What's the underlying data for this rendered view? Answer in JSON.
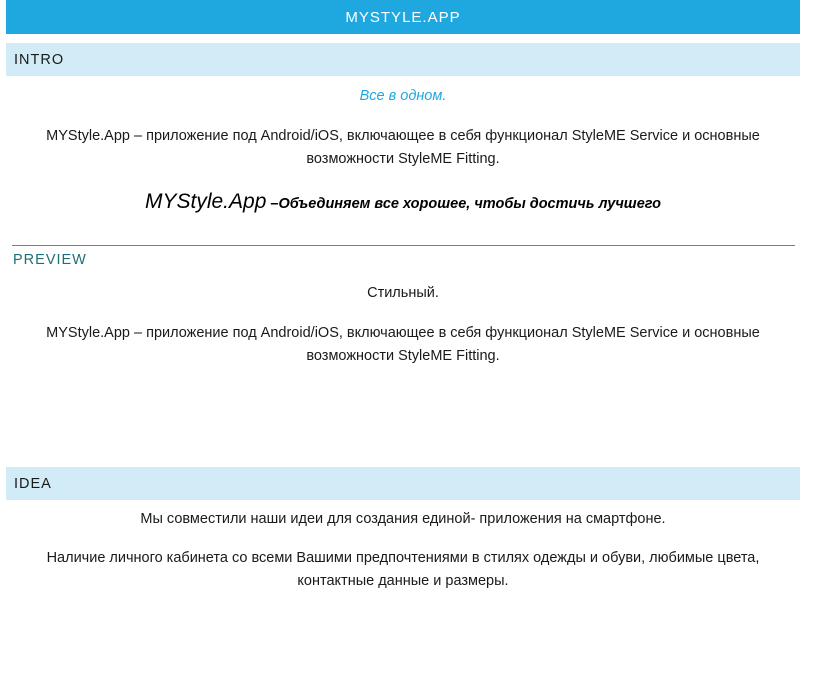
{
  "header": {
    "title": "MYSTYLE.APP"
  },
  "intro": {
    "heading": "INTRO",
    "tagline": "Все в одном.",
    "description": "MYStyle.App – приложение под Android/iOS, включающее в себя функционал StyleME Service и основные возможности StyleME Fitting.",
    "slogan_brand": "MYStyle.App",
    "slogan_tail": " –Объединяем все хорошее, чтобы достичь лучшего"
  },
  "preview": {
    "heading": "PREVIEW",
    "tagline": "Стильный.",
    "description": "MYStyle.App – приложение под Android/iOS, включающее в себя функционал StyleME Service и основные возможности StyleME Fitting."
  },
  "idea": {
    "heading": "IDEA",
    "line1": "Мы совместили наши идеи для создания единой- приложения на смартфоне.",
    "line2": "Наличие личного кабинета со всеми Вашими предпочтениями в стилях одежды и обуви, любимые цвета, контактные данные и размеры."
  },
  "colors": {
    "topbar": "#1fa8e0",
    "section_bar": "#d2ecf7",
    "rule": "#2d9aa7",
    "accent_text": "#1fa8e0"
  }
}
